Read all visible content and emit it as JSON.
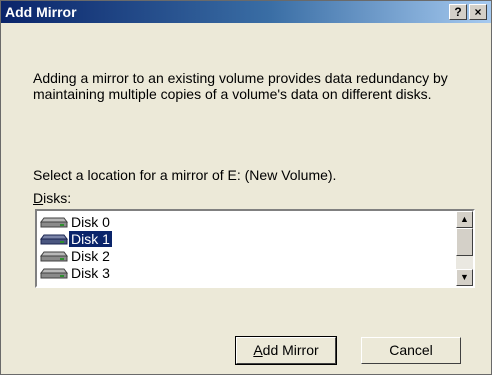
{
  "window": {
    "title": "Add Mirror",
    "help_label": "?",
    "close_label": "×"
  },
  "description": "Adding a mirror to an existing volume provides data redundancy by maintaining multiple copies of a volume's data on different disks.",
  "select_location_text": "Select a location for a mirror of E: (New Volume).",
  "disks_label": {
    "mnemonic": "D",
    "rest": "isks:"
  },
  "disks": [
    {
      "label": "Disk 0",
      "selected": false,
      "icon": "disk-drive-icon"
    },
    {
      "label": "Disk 1",
      "selected": true,
      "icon": "disk-drive-icon"
    },
    {
      "label": "Disk 2",
      "selected": false,
      "icon": "disk-drive-icon"
    },
    {
      "label": "Disk 3",
      "selected": false,
      "icon": "disk-drive-icon"
    }
  ],
  "scrollbar": {
    "up_glyph": "▲",
    "down_glyph": "▼"
  },
  "buttons": {
    "add_mirror": {
      "mnemonic": "A",
      "rest": "dd Mirror"
    },
    "cancel": "Cancel"
  },
  "colors": {
    "title_bar": "#0a246a",
    "selection": "#0a246a",
    "dialog_bg": "#ece9d8"
  }
}
